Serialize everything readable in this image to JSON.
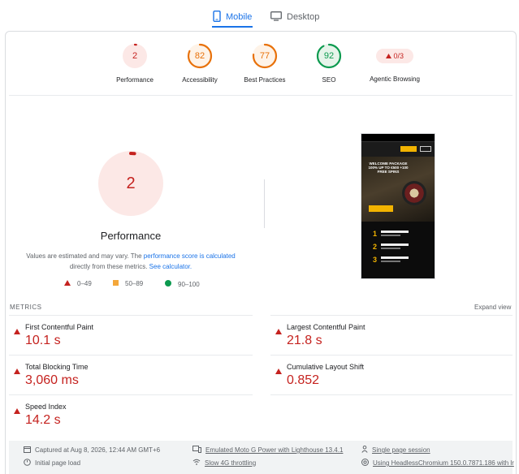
{
  "tabs": {
    "mobile": {
      "label": "Mobile",
      "icon": "phone-icon"
    },
    "desktop": {
      "label": "Desktop",
      "icon": "monitor-icon"
    }
  },
  "colors": {
    "fail": "#c5221f",
    "fail_bg": "#fce8e6",
    "average": "#e8710a",
    "average_bg": "#fef3e8",
    "pass": "#0c9a4f",
    "pass_bg": "#e6f4ea",
    "accent": "#1a73e8"
  },
  "scores": [
    {
      "label": "Performance",
      "value": "2",
      "level": "fail"
    },
    {
      "label": "Accessibility",
      "value": "82",
      "level": "average"
    },
    {
      "label": "Best Practices",
      "value": "77",
      "level": "average"
    },
    {
      "label": "SEO",
      "value": "92",
      "level": "pass"
    }
  ],
  "agentic": {
    "label": "Agentic Browsing",
    "value": "0/3"
  },
  "performance": {
    "score": "2",
    "title": "Performance",
    "desc_before": "Values are estimated and may vary. The ",
    "desc_link1": "performance score is calculated",
    "desc_middle": " directly from these metrics. ",
    "desc_link2": "See calculator."
  },
  "legend": [
    {
      "range": "0–49",
      "icon": "triangle-icon"
    },
    {
      "range": "50–89",
      "icon": "square-icon"
    },
    {
      "range": "90–100",
      "icon": "circle-icon"
    }
  ],
  "metrics": {
    "heading": "METRICS",
    "expand_label": "Expand view",
    "items": [
      {
        "title": "First Contentful Paint",
        "value": "10.1 s"
      },
      {
        "title": "Largest Contentful Paint",
        "value": "21.8 s"
      },
      {
        "title": "Total Blocking Time",
        "value": "3,060 ms"
      },
      {
        "title": "Cumulative Layout Shift",
        "value": "0.852"
      },
      {
        "title": "Speed Index",
        "value": "14.2 s"
      }
    ]
  },
  "screenshot": {
    "hero_text": "WELCOME PACKAGE 100% UP TO €500 +100 FREE SPINS"
  },
  "footer": {
    "captured": "Captured at Aug 8, 2026, 12:44 AM GMT+6",
    "initial": "Initial page load",
    "device": "Emulated Moto G Power with Lighthouse 13.4.1",
    "throttling": "Slow 4G throttling",
    "session": "Single page session",
    "browser": "Using HeadlessChromium 150.0.7871.186 with lr"
  }
}
